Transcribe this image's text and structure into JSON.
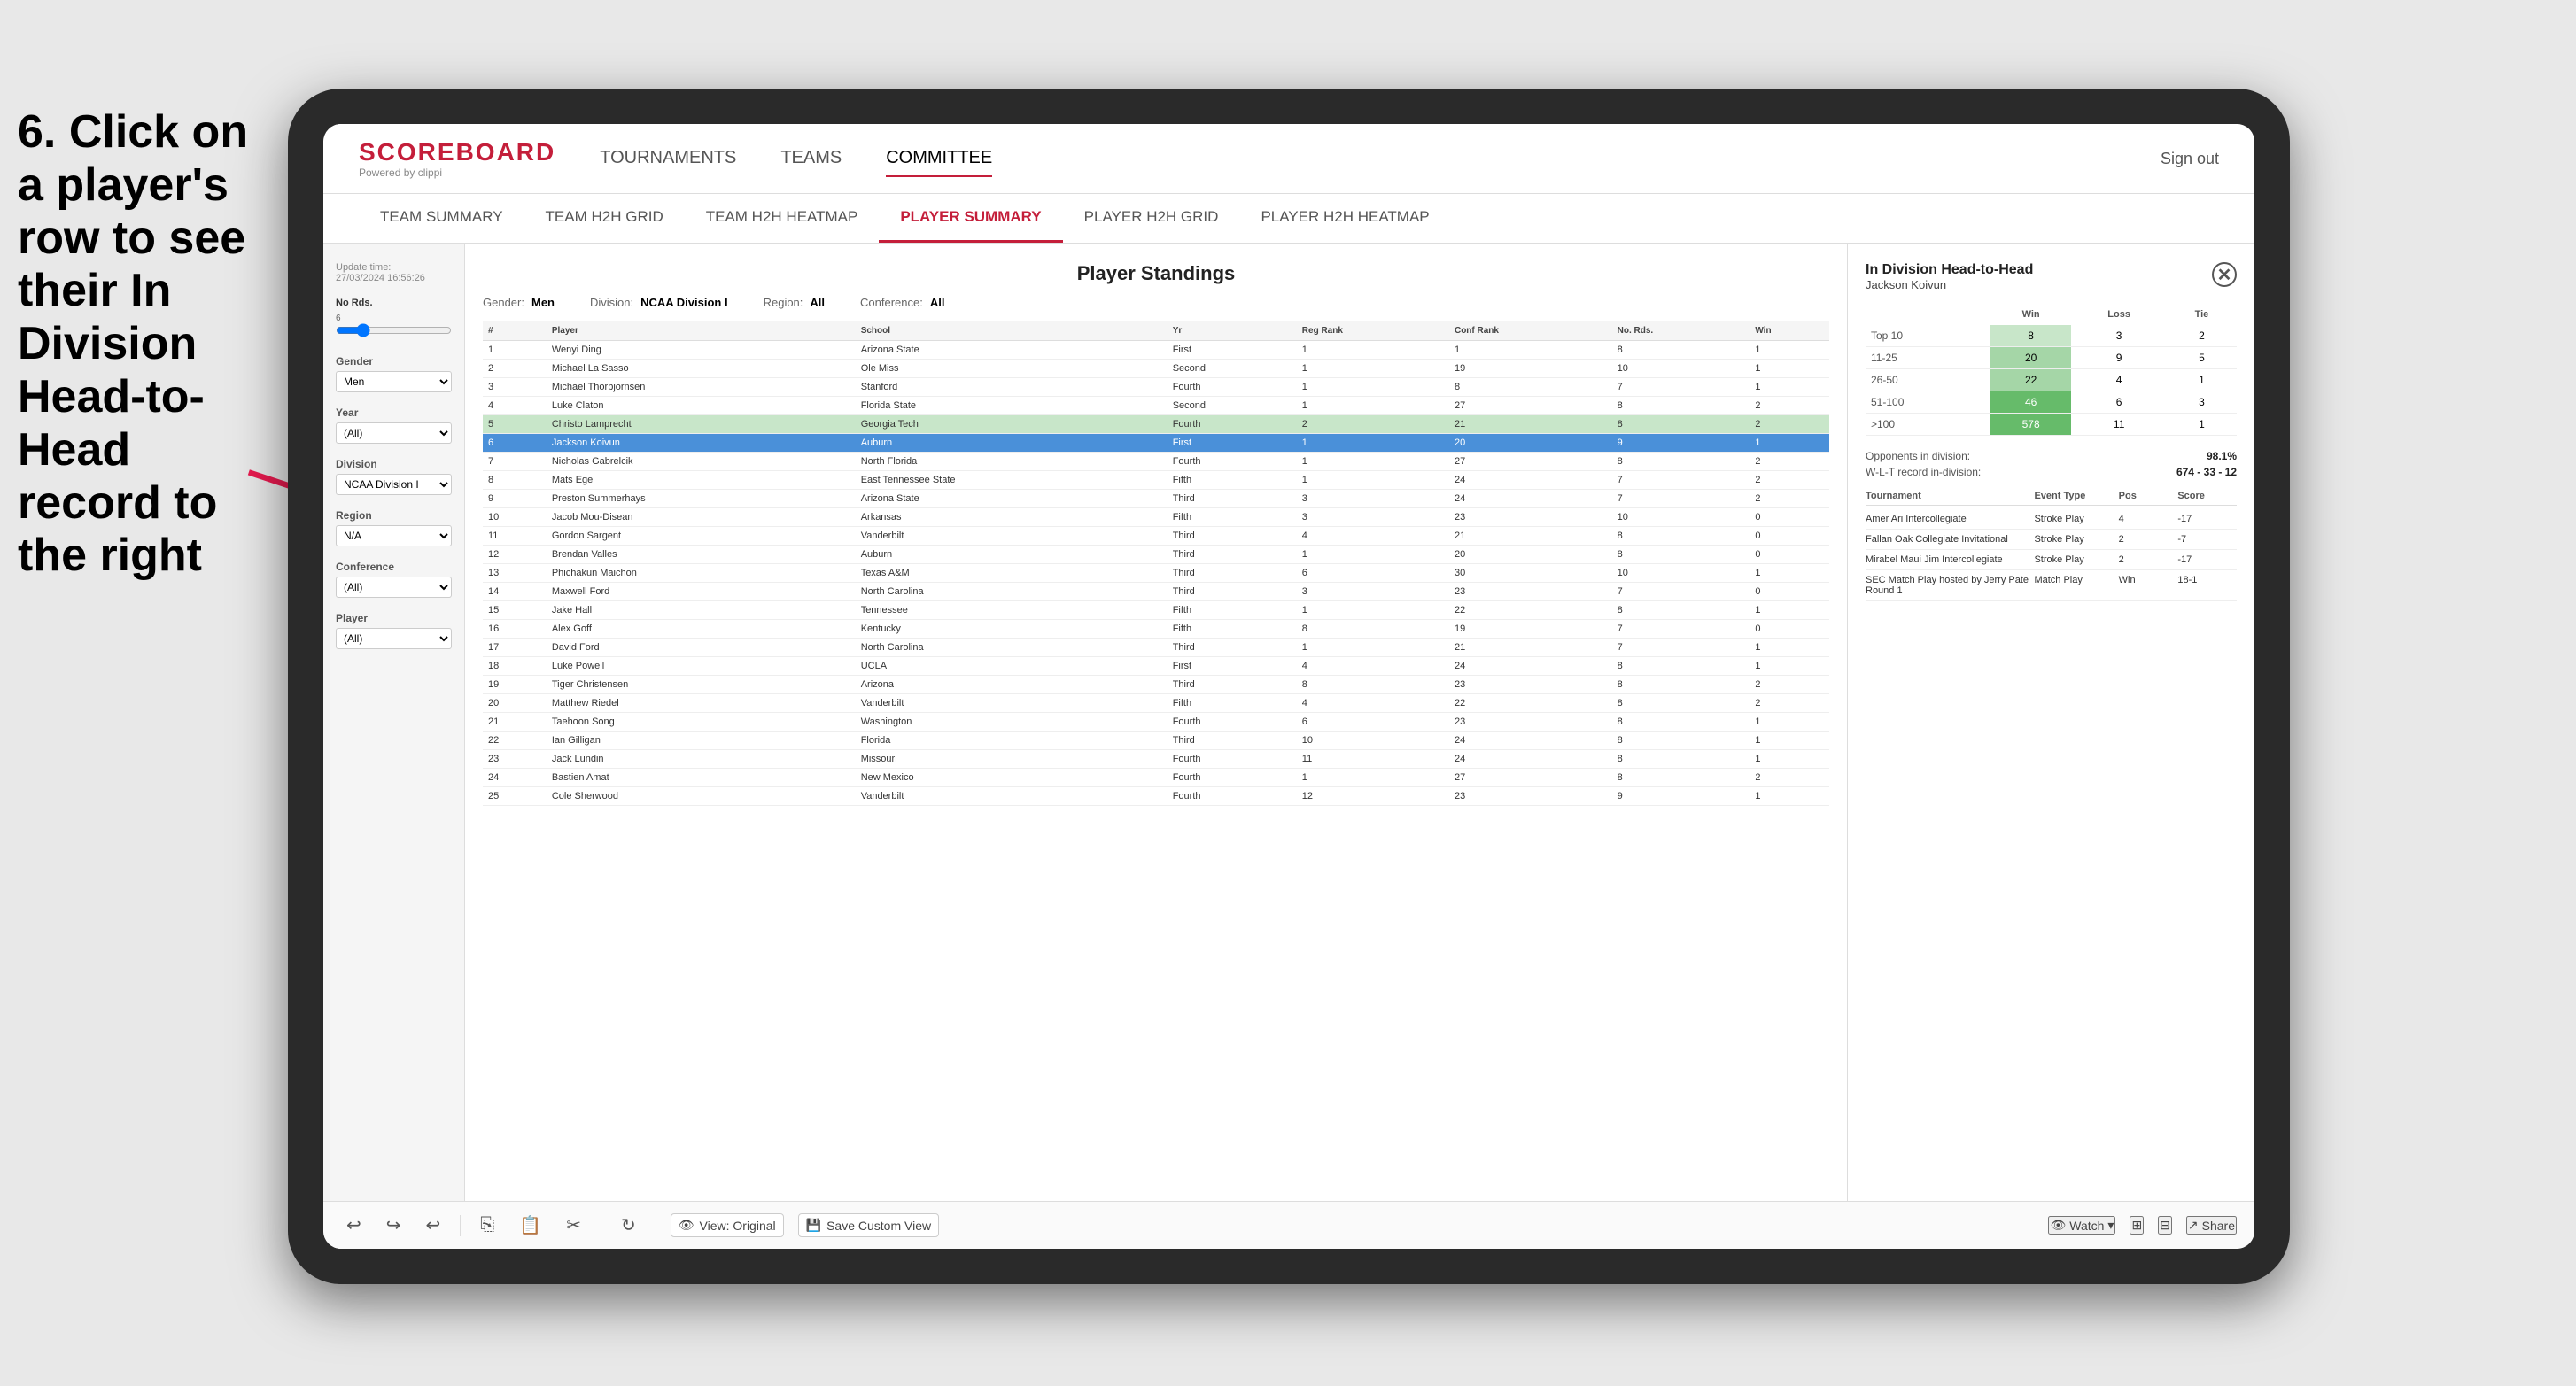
{
  "instruction": {
    "text": "6. Click on a player's row to see their In Division Head-to-Head record to the right"
  },
  "nav": {
    "logo": "SCOREBOARD",
    "powered_by": "Powered by clippi",
    "items": [
      "TOURNAMENTS",
      "TEAMS",
      "COMMITTEE"
    ],
    "active_item": "COMMITTEE",
    "sign_out": "Sign out"
  },
  "sub_nav": {
    "items": [
      "TEAM SUMMARY",
      "TEAM H2H GRID",
      "TEAM H2H HEATMAP",
      "PLAYER SUMMARY",
      "PLAYER H2H GRID",
      "PLAYER H2H HEATMAP"
    ],
    "active": "PLAYER SUMMARY"
  },
  "filters": {
    "update_time_label": "Update time:",
    "update_time_value": "27/03/2024 16:56:26",
    "no_rds_label": "No Rds.",
    "no_rds_min": "6",
    "gender_label": "Gender",
    "gender_value": "Men",
    "year_label": "Year",
    "year_value": "(All)",
    "division_label": "Division",
    "division_value": "NCAA Division I",
    "region_label": "Region",
    "region_value": "N/A",
    "conference_label": "Conference",
    "conference_value": "(All)",
    "player_label": "Player",
    "player_value": "(All)"
  },
  "standings": {
    "title": "Player Standings",
    "gender_label": "Gender:",
    "gender_value": "Men",
    "division_label": "Division:",
    "division_value": "NCAA Division I",
    "region_label": "Region:",
    "region_value": "All",
    "conference_label": "Conference:",
    "conference_value": "All",
    "columns": [
      "#",
      "Player",
      "School",
      "Yr",
      "Reg Rank",
      "Conf Rank",
      "No. Rds.",
      "Win"
    ],
    "rows": [
      {
        "num": 1,
        "player": "Wenyi Ding",
        "school": "Arizona State",
        "yr": "First",
        "reg": 1,
        "conf": 1,
        "rds": 8,
        "win": 1
      },
      {
        "num": 2,
        "player": "Michael La Sasso",
        "school": "Ole Miss",
        "yr": "Second",
        "reg": 1,
        "conf": 19,
        "rds": 10,
        "win": 1
      },
      {
        "num": 3,
        "player": "Michael Thorbjornsen",
        "school": "Stanford",
        "yr": "Fourth",
        "reg": 1,
        "conf": 8,
        "rds": 7,
        "win": 1
      },
      {
        "num": 4,
        "player": "Luke Claton",
        "school": "Florida State",
        "yr": "Second",
        "reg": 1,
        "conf": 27,
        "rds": 8,
        "win": 2
      },
      {
        "num": 5,
        "player": "Christo Lamprecht",
        "school": "Georgia Tech",
        "yr": "Fourth",
        "reg": 2,
        "conf": 21,
        "rds": 8,
        "win": 2
      },
      {
        "num": 6,
        "player": "Jackson Koivun",
        "school": "Auburn",
        "yr": "First",
        "reg": 1,
        "conf": 20,
        "rds": 9,
        "win": 1,
        "selected": true
      },
      {
        "num": 7,
        "player": "Nicholas Gabrelcik",
        "school": "North Florida",
        "yr": "Fourth",
        "reg": 1,
        "conf": 27,
        "rds": 8,
        "win": 2
      },
      {
        "num": 8,
        "player": "Mats Ege",
        "school": "East Tennessee State",
        "yr": "Fifth",
        "reg": 1,
        "conf": 24,
        "rds": 7,
        "win": 2
      },
      {
        "num": 9,
        "player": "Preston Summerhays",
        "school": "Arizona State",
        "yr": "Third",
        "reg": 3,
        "conf": 24,
        "rds": 7,
        "win": 2
      },
      {
        "num": 10,
        "player": "Jacob Mou-Disean",
        "school": "Arkansas",
        "yr": "Fifth",
        "reg": 3,
        "conf": 23,
        "rds": 10,
        "win": 0
      },
      {
        "num": 11,
        "player": "Gordon Sargent",
        "school": "Vanderbilt",
        "yr": "Third",
        "reg": 4,
        "conf": 21,
        "rds": 8,
        "win": 0
      },
      {
        "num": 12,
        "player": "Brendan Valles",
        "school": "Auburn",
        "yr": "Third",
        "reg": 1,
        "conf": 20,
        "rds": 8,
        "win": 0
      },
      {
        "num": 13,
        "player": "Phichakun Maichon",
        "school": "Texas A&M",
        "yr": "Third",
        "reg": 6,
        "conf": 30,
        "rds": 10,
        "win": 1
      },
      {
        "num": 14,
        "player": "Maxwell Ford",
        "school": "North Carolina",
        "yr": "Third",
        "reg": 3,
        "conf": 23,
        "rds": 7,
        "win": 0
      },
      {
        "num": 15,
        "player": "Jake Hall",
        "school": "Tennessee",
        "yr": "Fifth",
        "reg": 1,
        "conf": 22,
        "rds": 8,
        "win": 1
      },
      {
        "num": 16,
        "player": "Alex Goff",
        "school": "Kentucky",
        "yr": "Fifth",
        "reg": 8,
        "conf": 19,
        "rds": 7,
        "win": 0
      },
      {
        "num": 17,
        "player": "David Ford",
        "school": "North Carolina",
        "yr": "Third",
        "reg": 1,
        "conf": 21,
        "rds": 7,
        "win": 1
      },
      {
        "num": 18,
        "player": "Luke Powell",
        "school": "UCLA",
        "yr": "First",
        "reg": 4,
        "conf": 24,
        "rds": 8,
        "win": 1
      },
      {
        "num": 19,
        "player": "Tiger Christensen",
        "school": "Arizona",
        "yr": "Third",
        "reg": 8,
        "conf": 23,
        "rds": 8,
        "win": 2
      },
      {
        "num": 20,
        "player": "Matthew Riedel",
        "school": "Vanderbilt",
        "yr": "Fifth",
        "reg": 4,
        "conf": 22,
        "rds": 8,
        "win": 2
      },
      {
        "num": 21,
        "player": "Taehoon Song",
        "school": "Washington",
        "yr": "Fourth",
        "reg": 6,
        "conf": 23,
        "rds": 8,
        "win": 1
      },
      {
        "num": 22,
        "player": "Ian Gilligan",
        "school": "Florida",
        "yr": "Third",
        "reg": 10,
        "conf": 24,
        "rds": 8,
        "win": 1
      },
      {
        "num": 23,
        "player": "Jack Lundin",
        "school": "Missouri",
        "yr": "Fourth",
        "reg": 11,
        "conf": 24,
        "rds": 8,
        "win": 1
      },
      {
        "num": 24,
        "player": "Bastien Amat",
        "school": "New Mexico",
        "yr": "Fourth",
        "reg": 1,
        "conf": 27,
        "rds": 8,
        "win": 2
      },
      {
        "num": 25,
        "player": "Cole Sherwood",
        "school": "Vanderbilt",
        "yr": "Fourth",
        "reg": 12,
        "conf": 23,
        "rds": 9,
        "win": 1
      }
    ]
  },
  "h2h": {
    "title": "In Division Head-to-Head",
    "player": "Jackson Koivun",
    "table_headers": [
      "",
      "Win",
      "Loss",
      "Tie"
    ],
    "table_rows": [
      {
        "range": "Top 10",
        "win": 8,
        "loss": 3,
        "tie": 2,
        "win_level": "light"
      },
      {
        "range": "11-25",
        "win": 20,
        "loss": 9,
        "tie": 5,
        "win_level": "mid"
      },
      {
        "range": "26-50",
        "win": 22,
        "loss": 4,
        "tie": 1,
        "win_level": "mid"
      },
      {
        "range": "51-100",
        "win": 46,
        "loss": 6,
        "tie": 3,
        "win_level": "strong"
      },
      {
        "range": ">100",
        "win": 578,
        "loss": 11,
        "tie": 1,
        "win_level": "strong"
      }
    ],
    "opponents_label": "Opponents in division:",
    "opponents_value": "98.1%",
    "wlt_label": "W-L-T record in-division:",
    "wlt_value": "674 - 33 - 12",
    "tournaments_headers": [
      "Tournament",
      "Event Type",
      "Pos",
      "Score"
    ],
    "tournaments": [
      {
        "name": "Amer Ari Intercollegiate",
        "type": "Stroke Play",
        "pos": 4,
        "score": "-17"
      },
      {
        "name": "Fallan Oak Collegiate Invitational",
        "type": "Stroke Play",
        "pos": 2,
        "score": "-7"
      },
      {
        "name": "Mirabel Maui Jim Intercollegiate",
        "type": "Stroke Play",
        "pos": 2,
        "score": "-17"
      },
      {
        "name": "SEC Match Play hosted by Jerry Pate Round 1",
        "type": "Match Play",
        "pos": "Win",
        "score": "18-1"
      }
    ]
  },
  "toolbar": {
    "view_original": "View: Original",
    "save_custom": "Save Custom View",
    "watch": "Watch",
    "share": "Share"
  }
}
